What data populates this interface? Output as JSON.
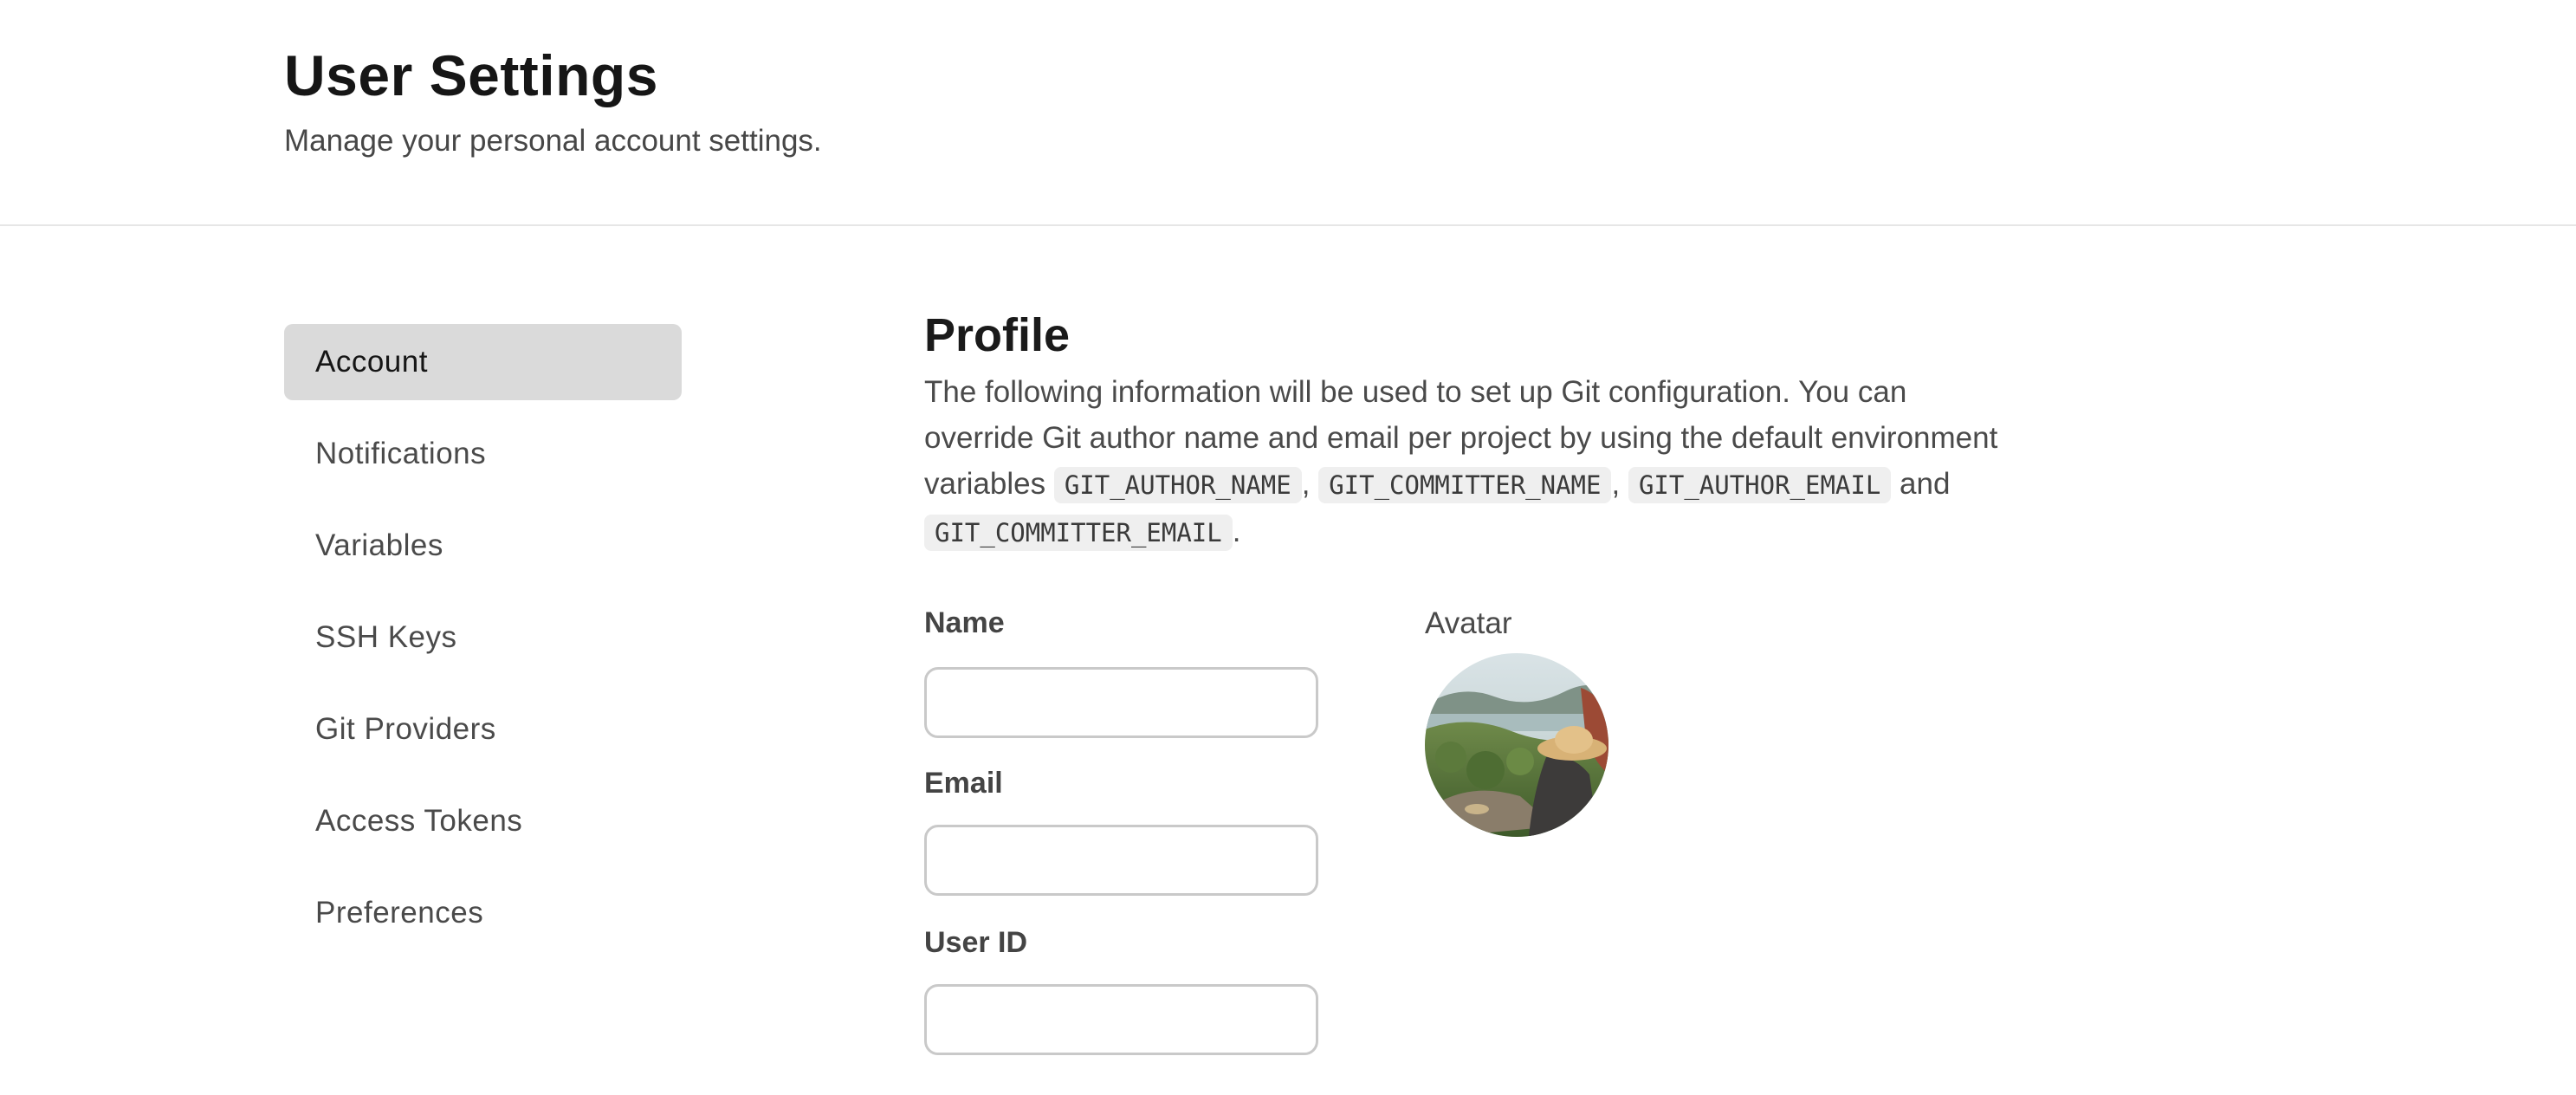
{
  "header": {
    "title": "User Settings",
    "subtitle": "Manage your personal account settings."
  },
  "sidebar": {
    "items": [
      {
        "label": "Account",
        "active": true
      },
      {
        "label": "Notifications",
        "active": false
      },
      {
        "label": "Variables",
        "active": false
      },
      {
        "label": "SSH Keys",
        "active": false
      },
      {
        "label": "Git Providers",
        "active": false
      },
      {
        "label": "Access Tokens",
        "active": false
      },
      {
        "label": "Preferences",
        "active": false
      }
    ]
  },
  "profile": {
    "title": "Profile",
    "description": {
      "part1": "The following information will be used to set up Git configuration. You can override Git author name and email per project by using the default environment variables",
      "env1": "GIT_AUTHOR_NAME",
      "sep1": ",",
      "env2": "GIT_COMMITTER_NAME",
      "sep2": ",",
      "env3": "GIT_AUTHOR_EMAIL",
      "and": "and",
      "env4": "GIT_COMMITTER_EMAIL",
      "end": "."
    },
    "fields": {
      "name": {
        "label": "Name",
        "value": "",
        "placeholder": ""
      },
      "email": {
        "label": "Email",
        "value": "",
        "placeholder": ""
      },
      "user_id": {
        "label": "User ID",
        "value": "",
        "placeholder": ""
      }
    },
    "avatar": {
      "label": "Avatar",
      "image": "landscape-photo-person-with-straw-hat"
    }
  },
  "colors": {
    "active_nav_bg": "#dadada",
    "input_border": "#c9c9c9",
    "code_bg": "#efefef",
    "divider": "#e6e6e6"
  }
}
